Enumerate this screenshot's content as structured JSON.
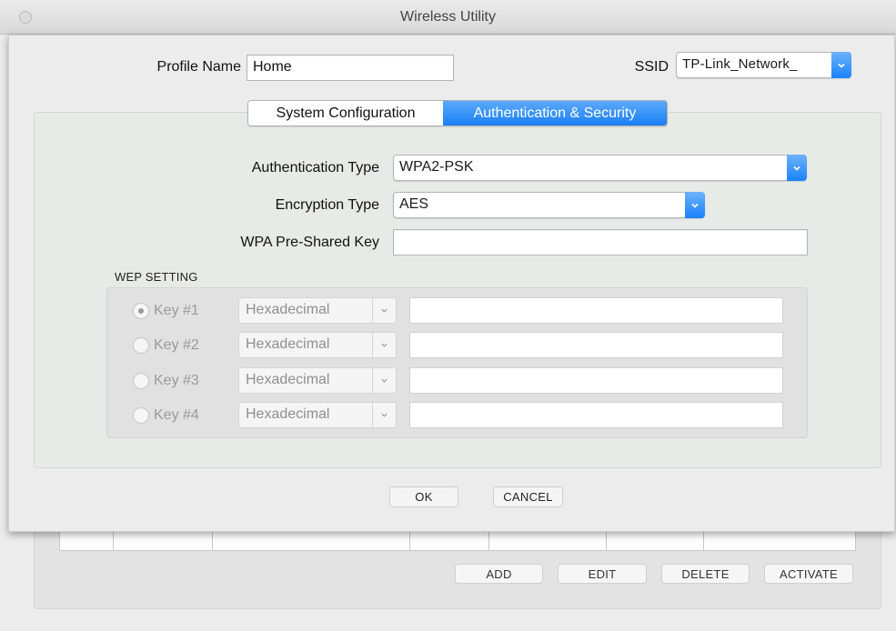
{
  "window": {
    "title": "Wireless Utility"
  },
  "profile": {
    "label": "Profile Name",
    "value": "Home"
  },
  "ssid": {
    "label": "SSID",
    "value": "TP-Link_Network_"
  },
  "tabs": [
    {
      "label": "System Configuration",
      "active": false
    },
    {
      "label": "Authentication & Security",
      "active": true
    }
  ],
  "auth": {
    "auth_type_label": "Authentication Type",
    "auth_type_value": "WPA2-PSK",
    "enc_type_label": "Encryption Type",
    "enc_type_value": "AES",
    "psk_label": "WPA Pre-Shared Key",
    "psk_value": ""
  },
  "wep": {
    "title": "WEP SETTING",
    "keys": [
      {
        "label": "Key #1",
        "format": "Hexadecimal",
        "selected": true,
        "value": ""
      },
      {
        "label": "Key #2",
        "format": "Hexadecimal",
        "selected": false,
        "value": ""
      },
      {
        "label": "Key #3",
        "format": "Hexadecimal",
        "selected": false,
        "value": ""
      },
      {
        "label": "Key #4",
        "format": "Hexadecimal",
        "selected": false,
        "value": ""
      }
    ]
  },
  "dialog_buttons": {
    "ok": "OK",
    "cancel": "CANCEL"
  },
  "main_buttons": {
    "add": "ADD",
    "edit": "EDIT",
    "delete": "DELETE",
    "activate": "ACTIVATE"
  },
  "colors": {
    "accent": "#1a82fb",
    "panel": "#e6ebe7"
  }
}
